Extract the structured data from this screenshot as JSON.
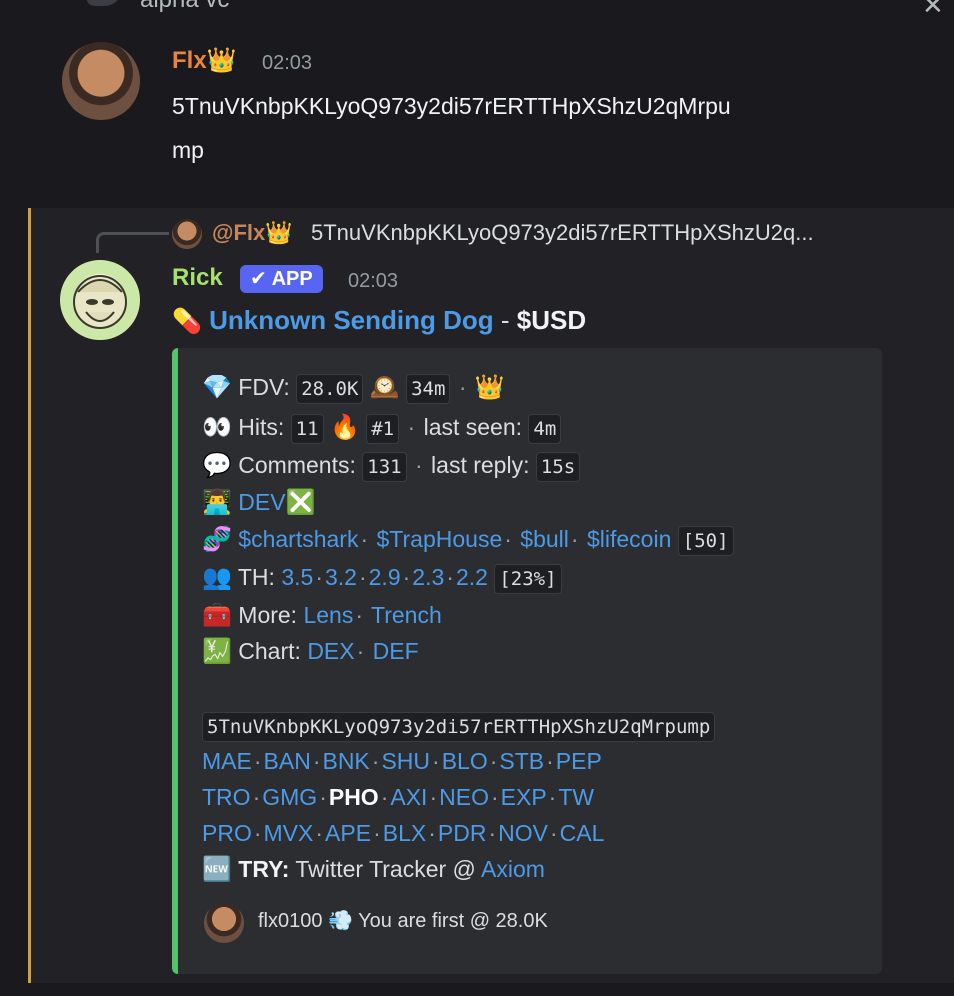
{
  "header": {
    "title": "alpha vc",
    "close_icon": "close-icon"
  },
  "message1": {
    "username": "Flx👑",
    "username_color": "#e8843c",
    "time": "02:03",
    "text_line1": "5TnuVKnbpKKLyoQ973y2di57rERTTHpXShzU2qMrpu",
    "text_line2": "mp"
  },
  "message2": {
    "reply": {
      "name": "@Flx👑",
      "text": "5TnuVKnbpKKLyoQ973y2di57rERTTHpXShzU2q..."
    },
    "username": "Rick",
    "username_color": "#a8e06e",
    "badge": "✔ APP",
    "time": "02:03",
    "title_icon": "💊",
    "title_link": "Unknown Sending Dog",
    "title_dash": " - ",
    "title_ticker": "$USD"
  },
  "embed": {
    "fdv": {
      "icon": "💎",
      "label": "FDV:",
      "value": "28.0K",
      "clock": "🕰️",
      "age": "34m",
      "sep": "·",
      "crown": "👑"
    },
    "hits": {
      "icon": "👀",
      "label": "Hits:",
      "value": "11",
      "fire": "🔥",
      "rank": "#1",
      "sep": "·",
      "seen_label": "last seen:",
      "seen": "4m"
    },
    "comments": {
      "icon": "💬",
      "label": "Comments:",
      "value": "131",
      "sep": "·",
      "reply_label": "last reply:",
      "reply": "15s"
    },
    "dev": {
      "icon": "👨‍💻",
      "label": "DEV",
      "status": "❎"
    },
    "dna": {
      "icon": "🧬",
      "coins": [
        "$chartshark",
        "$TrapHouse",
        "$bull",
        "$lifecoin"
      ],
      "count": "[50]"
    },
    "th": {
      "icon": "👥",
      "label": "TH:",
      "values": [
        "3.5",
        "3.2",
        "2.9",
        "2.3",
        "2.2"
      ],
      "pct": "[23%]"
    },
    "more": {
      "icon": "🧰",
      "label": "More:",
      "links": [
        "Lens",
        "Trench"
      ]
    },
    "chart": {
      "icon": "💹",
      "label": "Chart:",
      "links": [
        "DEX",
        "DEF"
      ]
    },
    "ca": "5TnuVKnbpKKLyoQ973y2di57rERTTHpXShzU2qMrpump",
    "row1": [
      "MAE",
      "BAN",
      "BNK",
      "SHU",
      "BLO",
      "STB",
      "PEP"
    ],
    "row2": [
      "TRO",
      "GMG",
      "PHO",
      "AXI",
      "NEO",
      "EXP",
      "TW"
    ],
    "row3": [
      "PRO",
      "MVX",
      "APE",
      "BLX",
      "PDR",
      "NOV",
      "CAL"
    ],
    "try": {
      "icon": "🆕",
      "label": "TRY:",
      "text": " Twitter Tracker @ ",
      "link": "Axiom"
    },
    "footer": "flx0100 💨 You are first @ 28.0K"
  },
  "colors": {
    "link": "#4d9ae6",
    "embed_bar": "#57c26b",
    "reply_bar": "#d39f3a",
    "badge": "#5865f2"
  }
}
